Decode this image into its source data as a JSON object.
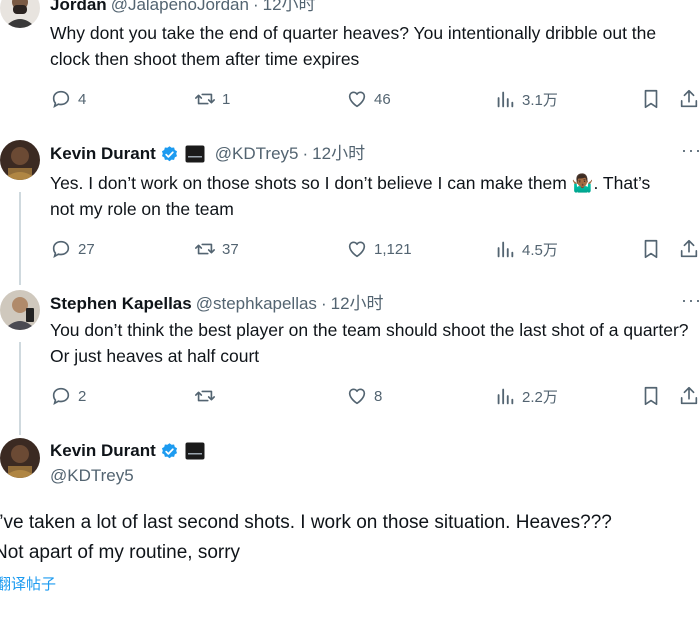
{
  "tweets": [
    {
      "name": "Jordan",
      "handle": "@JalapenoJordan",
      "dot": "·",
      "time": "12小时",
      "text": "Why dont you take the end of quarter heaves? You intentionally dribble out the clock then shoot them after time expires",
      "replies": "4",
      "retweets": "1",
      "likes": "46",
      "views": "3.1万"
    },
    {
      "name": "Kevin Durant",
      "handle": "@KDTrey5",
      "dot": "·",
      "time": "12小时",
      "text": "Yes. I don’t work on those shots so I don’t believe I can make them 🤷🏾‍♂️. That’s not my role on the team",
      "replies": "27",
      "retweets": "37",
      "likes": "1,121",
      "views": "4.5万"
    },
    {
      "name": "Stephen Kapellas",
      "handle": "@stephkapellas",
      "dot": "·",
      "time": "12小时",
      "text": "You don’t think the best player on the team should shoot the last shot of a quarter? Or just heaves at half court",
      "replies": "2",
      "retweets": "",
      "likes": "8",
      "views": "2.2万"
    }
  ],
  "main_tweet": {
    "name": "Kevin Durant",
    "handle": "@KDTrey5",
    "text_line1": "I’ve taken a lot of last second shots. I work on those situation. Heaves???",
    "text_line2": "Not apart of my routine, sorry",
    "translate": "翻译帖子"
  },
  "more_label": "···",
  "icons": {
    "reply": "reply-icon",
    "retweet": "retweet-icon",
    "like": "heart-icon",
    "views": "views-icon",
    "bookmark": "bookmark-icon",
    "share": "share-icon",
    "verified": "verified-badge-icon",
    "affiliate": "affiliate-badge-icon"
  },
  "colors": {
    "text": "#0f1419",
    "secondary": "#536471",
    "verified_blue": "#1d9bf0",
    "thread_line": "#cfd9de"
  }
}
